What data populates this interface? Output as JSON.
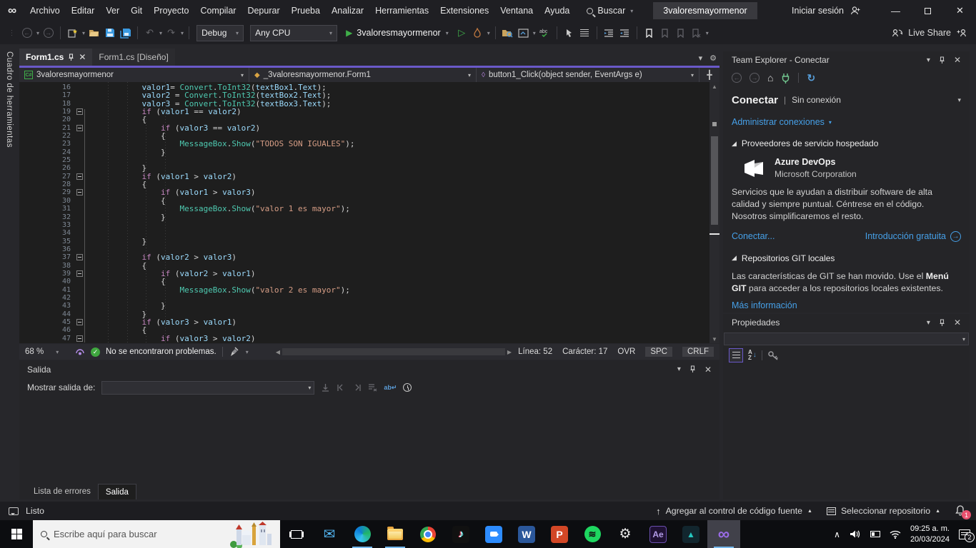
{
  "window": {
    "title": "3valoresmayormenor",
    "sign_in": "Iniciar sesión"
  },
  "menubar": {
    "items": [
      "Archivo",
      "Editar",
      "Ver",
      "Git",
      "Proyecto",
      "Compilar",
      "Depurar",
      "Prueba",
      "Analizar",
      "Herramientas",
      "Extensiones",
      "Ventana",
      "Ayuda"
    ],
    "search_label": "Buscar"
  },
  "toolbar": {
    "config": "Debug",
    "platform": "Any CPU",
    "run_label": "3valoresmayormenor",
    "live_share_label": "Live Share"
  },
  "toolbox_tab": "Cuadro de herramientas",
  "editor": {
    "tabs": [
      {
        "label": "Form1.cs"
      },
      {
        "label": "Form1.cs [Diseño]"
      }
    ],
    "nav": {
      "project": "3valoresmayormenor",
      "type": "_3valoresmayormenor.Form1",
      "member": "button1_Click(object sender, EventArgs e)"
    },
    "code": [
      {
        "n": 16,
        "s": [
          [
            "w",
            "            "
          ],
          [
            "v",
            "valor1"
          ],
          [
            "p",
            "= "
          ],
          [
            "t",
            "Convert"
          ],
          [
            "p",
            "."
          ],
          [
            "t",
            "ToInt32"
          ],
          [
            "p",
            "("
          ],
          [
            "v",
            "textBox1"
          ],
          [
            "p",
            "."
          ],
          [
            "v",
            "Text"
          ],
          [
            "p",
            ");"
          ]
        ]
      },
      {
        "n": 17,
        "s": [
          [
            "w",
            "            "
          ],
          [
            "v",
            "valor2"
          ],
          [
            "p",
            " = "
          ],
          [
            "t",
            "Convert"
          ],
          [
            "p",
            "."
          ],
          [
            "t",
            "ToInt32"
          ],
          [
            "p",
            "("
          ],
          [
            "v",
            "textBox2"
          ],
          [
            "p",
            "."
          ],
          [
            "v",
            "Text"
          ],
          [
            "p",
            ");"
          ]
        ]
      },
      {
        "n": 18,
        "s": [
          [
            "w",
            "            "
          ],
          [
            "v",
            "valor3"
          ],
          [
            "p",
            " = "
          ],
          [
            "t",
            "Convert"
          ],
          [
            "p",
            "."
          ],
          [
            "t",
            "ToInt32"
          ],
          [
            "p",
            "("
          ],
          [
            "v",
            "textBox3"
          ],
          [
            "p",
            "."
          ],
          [
            "v",
            "Text"
          ],
          [
            "p",
            ");"
          ]
        ]
      },
      {
        "n": 19,
        "f": true,
        "s": [
          [
            "w",
            "            "
          ],
          [
            "k",
            "if"
          ],
          [
            "p",
            " ("
          ],
          [
            "v",
            "valor1"
          ],
          [
            "p",
            " "
          ],
          [
            "o",
            "=="
          ],
          [
            "p",
            " "
          ],
          [
            "v",
            "valor2"
          ],
          [
            "p",
            ")"
          ]
        ]
      },
      {
        "n": 20,
        "s": [
          [
            "w",
            "            "
          ],
          [
            "p",
            "{"
          ]
        ]
      },
      {
        "n": 21,
        "f": true,
        "s": [
          [
            "w",
            "                "
          ],
          [
            "k",
            "if"
          ],
          [
            "p",
            " ("
          ],
          [
            "v",
            "valor3"
          ],
          [
            "p",
            " "
          ],
          [
            "o",
            "=="
          ],
          [
            "p",
            " "
          ],
          [
            "v",
            "valor2"
          ],
          [
            "p",
            ")"
          ]
        ]
      },
      {
        "n": 22,
        "s": [
          [
            "w",
            "                "
          ],
          [
            "p",
            "{"
          ]
        ]
      },
      {
        "n": 23,
        "s": [
          [
            "w",
            "                    "
          ],
          [
            "t",
            "MessageBox"
          ],
          [
            "p",
            "."
          ],
          [
            "t",
            "Show"
          ],
          [
            "p",
            "("
          ],
          [
            "s",
            "\"TODOS SON IGUALES\""
          ],
          [
            "p",
            ");"
          ]
        ]
      },
      {
        "n": 24,
        "s": [
          [
            "w",
            "                "
          ],
          [
            "p",
            "}"
          ]
        ]
      },
      {
        "n": 25,
        "s": []
      },
      {
        "n": 26,
        "s": [
          [
            "w",
            "            "
          ],
          [
            "p",
            "}"
          ]
        ]
      },
      {
        "n": 27,
        "f": true,
        "s": [
          [
            "w",
            "            "
          ],
          [
            "k",
            "if"
          ],
          [
            "p",
            " ("
          ],
          [
            "v",
            "valor1"
          ],
          [
            "p",
            " "
          ],
          [
            "o",
            ">"
          ],
          [
            "p",
            " "
          ],
          [
            "v",
            "valor2"
          ],
          [
            "p",
            ")"
          ]
        ]
      },
      {
        "n": 28,
        "s": [
          [
            "w",
            "            "
          ],
          [
            "p",
            "{"
          ]
        ]
      },
      {
        "n": 29,
        "f": true,
        "s": [
          [
            "w",
            "                "
          ],
          [
            "k",
            "if"
          ],
          [
            "p",
            " ("
          ],
          [
            "v",
            "valor1"
          ],
          [
            "p",
            " "
          ],
          [
            "o",
            ">"
          ],
          [
            "p",
            " "
          ],
          [
            "v",
            "valor3"
          ],
          [
            "p",
            ")"
          ]
        ]
      },
      {
        "n": 30,
        "s": [
          [
            "w",
            "                "
          ],
          [
            "p",
            "{"
          ]
        ]
      },
      {
        "n": 31,
        "s": [
          [
            "w",
            "                    "
          ],
          [
            "t",
            "MessageBox"
          ],
          [
            "p",
            "."
          ],
          [
            "t",
            "Show"
          ],
          [
            "p",
            "("
          ],
          [
            "s",
            "\"valor 1 es mayor\""
          ],
          [
            "p",
            ");"
          ]
        ]
      },
      {
        "n": 32,
        "s": [
          [
            "w",
            "                "
          ],
          [
            "p",
            "}"
          ]
        ]
      },
      {
        "n": 33,
        "s": []
      },
      {
        "n": 34,
        "s": []
      },
      {
        "n": 35,
        "s": [
          [
            "w",
            "            "
          ],
          [
            "p",
            "}"
          ]
        ]
      },
      {
        "n": 36,
        "s": []
      },
      {
        "n": 37,
        "f": true,
        "s": [
          [
            "w",
            "            "
          ],
          [
            "k",
            "if"
          ],
          [
            "p",
            " ("
          ],
          [
            "v",
            "valor2"
          ],
          [
            "p",
            " "
          ],
          [
            "o",
            ">"
          ],
          [
            "p",
            " "
          ],
          [
            "v",
            "valor3"
          ],
          [
            "p",
            ")"
          ]
        ]
      },
      {
        "n": 38,
        "s": [
          [
            "w",
            "            "
          ],
          [
            "p",
            "{"
          ]
        ]
      },
      {
        "n": 39,
        "f": true,
        "s": [
          [
            "w",
            "                "
          ],
          [
            "k",
            "if"
          ],
          [
            "p",
            " ("
          ],
          [
            "v",
            "valor2"
          ],
          [
            "p",
            " "
          ],
          [
            "o",
            ">"
          ],
          [
            "p",
            " "
          ],
          [
            "v",
            "valor1"
          ],
          [
            "p",
            ")"
          ]
        ]
      },
      {
        "n": 40,
        "s": [
          [
            "w",
            "                "
          ],
          [
            "p",
            "{"
          ]
        ]
      },
      {
        "n": 41,
        "s": [
          [
            "w",
            "                    "
          ],
          [
            "t",
            "MessageBox"
          ],
          [
            "p",
            "."
          ],
          [
            "t",
            "Show"
          ],
          [
            "p",
            "("
          ],
          [
            "s",
            "\"valor 2 es mayor\""
          ],
          [
            "p",
            ");"
          ]
        ]
      },
      {
        "n": 42,
        "s": []
      },
      {
        "n": 43,
        "s": [
          [
            "w",
            "                "
          ],
          [
            "p",
            "}"
          ]
        ]
      },
      {
        "n": 44,
        "s": [
          [
            "w",
            "            "
          ],
          [
            "p",
            "}"
          ]
        ]
      },
      {
        "n": 45,
        "f": true,
        "s": [
          [
            "w",
            "            "
          ],
          [
            "k",
            "if"
          ],
          [
            "p",
            " ("
          ],
          [
            "v",
            "valor3"
          ],
          [
            "p",
            " "
          ],
          [
            "o",
            ">"
          ],
          [
            "p",
            " "
          ],
          [
            "v",
            "valor1"
          ],
          [
            "p",
            ")"
          ]
        ]
      },
      {
        "n": 46,
        "s": [
          [
            "w",
            "            "
          ],
          [
            "p",
            "{"
          ]
        ]
      },
      {
        "n": 47,
        "f": true,
        "s": [
          [
            "w",
            "                "
          ],
          [
            "k",
            "if"
          ],
          [
            "p",
            " ("
          ],
          [
            "v",
            "valor3"
          ],
          [
            "p",
            " "
          ],
          [
            "o",
            ">"
          ],
          [
            "p",
            " "
          ],
          [
            "v",
            "valor2"
          ],
          [
            "p",
            ")"
          ]
        ]
      }
    ],
    "statusbar": {
      "zoom": "68 %",
      "problems": "No se encontraron problemas.",
      "line": "Línea: 52",
      "char": "Carácter: 17",
      "ovr": "OVR",
      "spc": "SPC",
      "crlf": "CRLF"
    }
  },
  "output_panel": {
    "title": "Salida",
    "show_output_label": "Mostrar salida de:",
    "tabs": [
      {
        "label": "Lista de errores"
      },
      {
        "label": "Salida"
      }
    ]
  },
  "team_explorer": {
    "title": "Team Explorer - Conectar",
    "page_title": "Conectar",
    "page_status": "Sin conexión",
    "manage_link": "Administrar conexiones",
    "section_providers": "Proveedores de servicio hospedado",
    "azure": {
      "name": "Azure DevOps",
      "vendor": "Microsoft Corporation",
      "desc": "Servicios que le ayudan a distribuir software de alta calidad y siempre puntual. Céntrese en el código. Nosotros simplificaremos el resto.",
      "connect_link": "Conectar...",
      "intro_link": "Introducción gratuita"
    },
    "section_git": "Repositorios GIT locales",
    "git_text_pre": "Las características de GIT se han movido. Use el ",
    "git_text_bold": "Menú GIT",
    "git_text_post": " para acceder a los repositorios locales existentes.",
    "more_info_link": "Más información"
  },
  "properties_panel": {
    "title": "Propiedades"
  },
  "vs_statusbar": {
    "ready": "Listo",
    "add_source_control": "Agregar al control de código fuente",
    "select_repo": "Seleccionar repositorio",
    "bell_badge": "1"
  },
  "taskbar": {
    "search_placeholder": "Escribe aquí para buscar",
    "time": "09:25 a. m.",
    "date": "20/03/2024",
    "notif_badge": "2",
    "pinned_icons": [
      "mail",
      "edge",
      "file-explorer",
      "chrome",
      "tiktok",
      "zoom",
      "word",
      "powerpoint",
      "spotify",
      "settings",
      "after-effects",
      "media-app",
      "visual-studio"
    ],
    "tray_icons": [
      "show-hidden",
      "volume",
      "battery",
      "wifi",
      "action-center"
    ]
  },
  "accent_colors": {
    "purple_line": "#6a59c9",
    "link_blue": "#46a0e8",
    "run_green": "#3fae49",
    "badge_red": "#e8506e"
  }
}
